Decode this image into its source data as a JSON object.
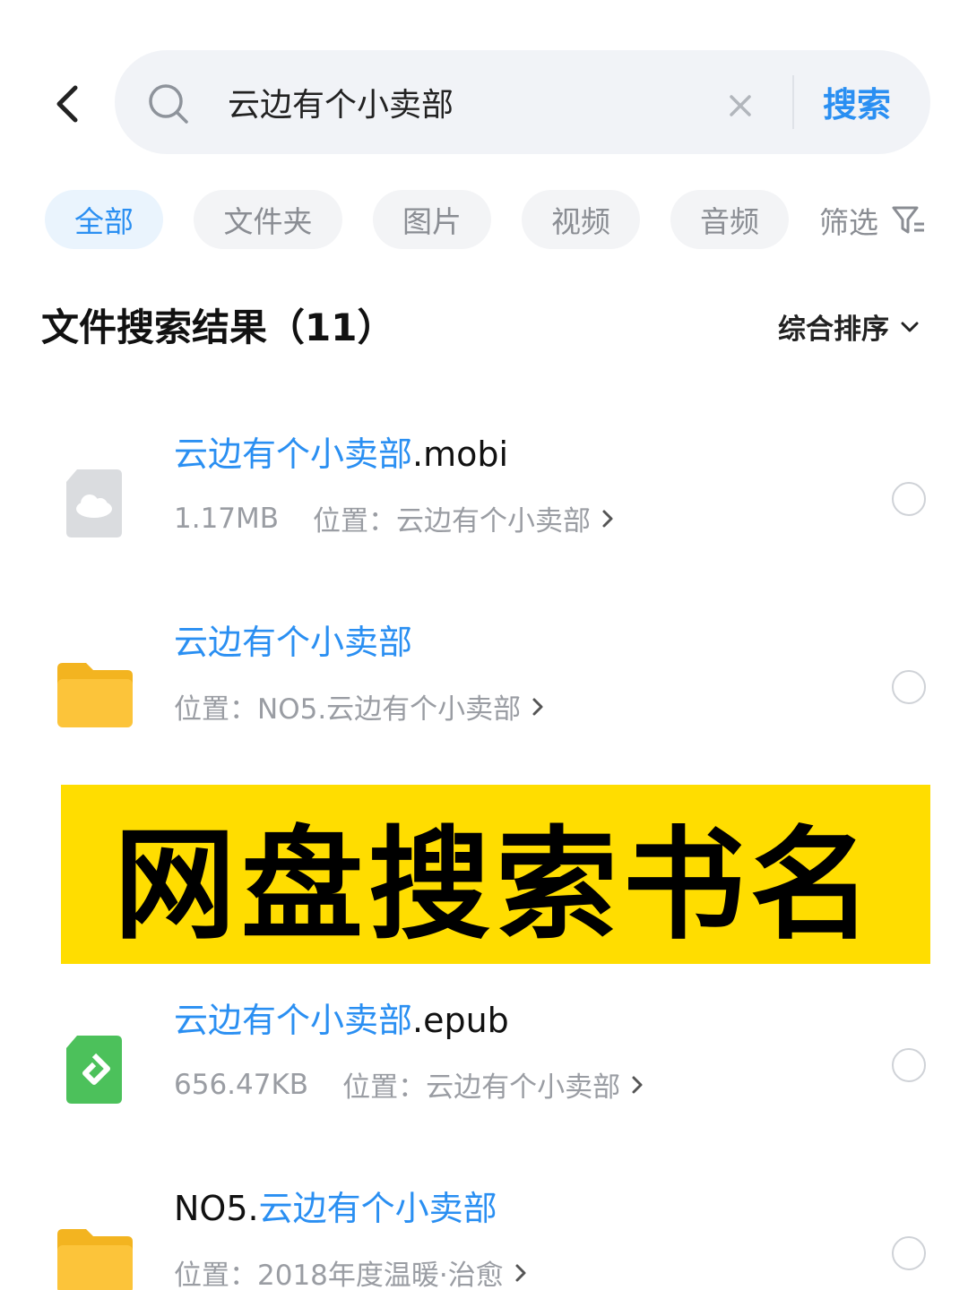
{
  "search": {
    "query": "云边有个小卖部",
    "submit_label": "搜索"
  },
  "chips": [
    {
      "label": "全部",
      "active": true
    },
    {
      "label": "文件夹",
      "active": false
    },
    {
      "label": "图片",
      "active": false
    },
    {
      "label": "视频",
      "active": false
    },
    {
      "label": "音频",
      "active": false
    }
  ],
  "filter_label": "筛选",
  "section": {
    "title": "文件搜索结果（11）",
    "sort_label": "综合排序"
  },
  "results": [
    {
      "name_prefix": "",
      "name_highlight": "云边有个小卖部",
      "name_suffix": ".mobi",
      "size": "1.17MB",
      "location_label": "位置：",
      "location": "云边有个小卖部",
      "icon": "cloud-file-icon"
    },
    {
      "name_prefix": "",
      "name_highlight": "云边有个小卖部",
      "name_suffix": "",
      "size": "",
      "location_label": "位置：",
      "location": "NO5.云边有个小卖部",
      "icon": "folder-icon"
    },
    {
      "name_prefix": "",
      "name_highlight": "云边有个小卖部",
      "name_suffix": ".epub",
      "size": "656.47KB",
      "location_label": "位置：",
      "location": "云边有个小卖部",
      "icon": "epub-icon"
    },
    {
      "name_prefix": "NO5.",
      "name_highlight": "云边有个小卖部",
      "name_suffix": "",
      "size": "",
      "location_label": "位置：",
      "location": "2018年度温暖·治愈",
      "icon": "folder-icon"
    }
  ],
  "banner": {
    "text": "网盘搜索书名"
  },
  "colors": {
    "accent": "#2a8ff2",
    "banner_bg": "#ffdd00",
    "folder": "#fcc43a",
    "epub": "#4cc15b"
  }
}
